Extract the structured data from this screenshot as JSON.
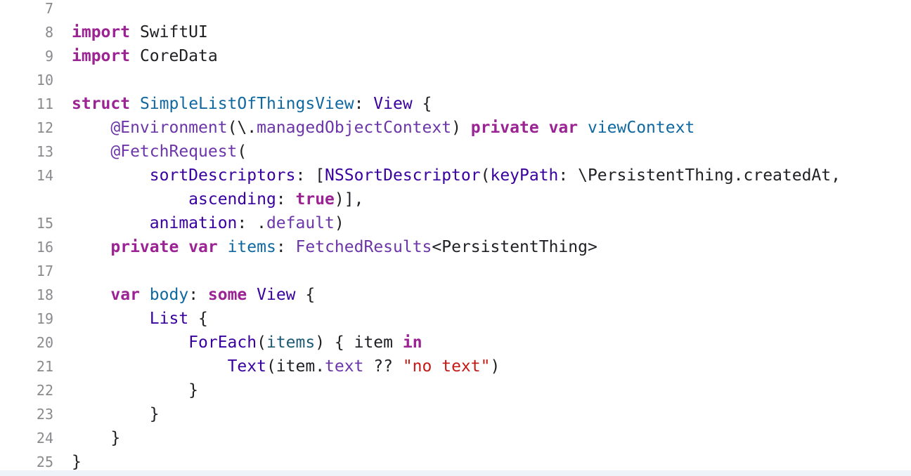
{
  "editor": {
    "lines": [
      {
        "num": "7",
        "tokens": []
      },
      {
        "num": "8",
        "tokens": [
          {
            "t": "import",
            "c": "kw"
          },
          {
            "t": " SwiftUI",
            "c": "plain"
          }
        ]
      },
      {
        "num": "9",
        "tokens": [
          {
            "t": "import",
            "c": "kw"
          },
          {
            "t": " CoreData",
            "c": "plain"
          }
        ]
      },
      {
        "num": "10",
        "tokens": []
      },
      {
        "num": "11",
        "tokens": [
          {
            "t": "struct",
            "c": "kw"
          },
          {
            "t": " ",
            "c": "plain"
          },
          {
            "t": "SimpleListOfThingsView",
            "c": "decl"
          },
          {
            "t": ": ",
            "c": "plain"
          },
          {
            "t": "View",
            "c": "type"
          },
          {
            "t": " {",
            "c": "plain"
          }
        ]
      },
      {
        "num": "12",
        "tokens": [
          {
            "t": "    ",
            "c": "plain"
          },
          {
            "t": "@Environment",
            "c": "prop"
          },
          {
            "t": "(\\.",
            "c": "plain"
          },
          {
            "t": "managedObjectContext",
            "c": "prop"
          },
          {
            "t": ") ",
            "c": "plain"
          },
          {
            "t": "private",
            "c": "kw"
          },
          {
            "t": " ",
            "c": "plain"
          },
          {
            "t": "var",
            "c": "kw"
          },
          {
            "t": " ",
            "c": "plain"
          },
          {
            "t": "viewContext",
            "c": "decl"
          }
        ]
      },
      {
        "num": "13",
        "tokens": [
          {
            "t": "    ",
            "c": "plain"
          },
          {
            "t": "@FetchRequest",
            "c": "prop"
          },
          {
            "t": "(",
            "c": "plain"
          }
        ]
      },
      {
        "num": "14",
        "tokens": [
          {
            "t": "        ",
            "c": "plain"
          },
          {
            "t": "sortDescriptors",
            "c": "type"
          },
          {
            "t": ": [",
            "c": "plain"
          },
          {
            "t": "NSSortDescriptor",
            "c": "type"
          },
          {
            "t": "(",
            "c": "plain"
          },
          {
            "t": "keyPath",
            "c": "type"
          },
          {
            "t": ": \\PersistentThing.createdAt,",
            "c": "plain"
          }
        ]
      },
      {
        "num": "",
        "tokens": [
          {
            "t": "            ",
            "c": "plain"
          },
          {
            "t": "ascending",
            "c": "type"
          },
          {
            "t": ": ",
            "c": "plain"
          },
          {
            "t": "true",
            "c": "kw"
          },
          {
            "t": ")],",
            "c": "plain"
          }
        ]
      },
      {
        "num": "15",
        "tokens": [
          {
            "t": "        ",
            "c": "plain"
          },
          {
            "t": "animation",
            "c": "type"
          },
          {
            "t": ": .",
            "c": "plain"
          },
          {
            "t": "default",
            "c": "prop"
          },
          {
            "t": ")",
            "c": "plain"
          }
        ]
      },
      {
        "num": "16",
        "tokens": [
          {
            "t": "    ",
            "c": "plain"
          },
          {
            "t": "private",
            "c": "kw"
          },
          {
            "t": " ",
            "c": "plain"
          },
          {
            "t": "var",
            "c": "kw"
          },
          {
            "t": " ",
            "c": "plain"
          },
          {
            "t": "items",
            "c": "decl"
          },
          {
            "t": ": ",
            "c": "plain"
          },
          {
            "t": "FetchedResults",
            "c": "prop"
          },
          {
            "t": "<PersistentThing>",
            "c": "plain"
          }
        ]
      },
      {
        "num": "17",
        "tokens": []
      },
      {
        "num": "18",
        "tokens": [
          {
            "t": "    ",
            "c": "plain"
          },
          {
            "t": "var",
            "c": "kw"
          },
          {
            "t": " ",
            "c": "plain"
          },
          {
            "t": "body",
            "c": "decl"
          },
          {
            "t": ": ",
            "c": "plain"
          },
          {
            "t": "some",
            "c": "kw"
          },
          {
            "t": " ",
            "c": "plain"
          },
          {
            "t": "View",
            "c": "type"
          },
          {
            "t": " {",
            "c": "plain"
          }
        ]
      },
      {
        "num": "19",
        "tokens": [
          {
            "t": "        ",
            "c": "plain"
          },
          {
            "t": "List",
            "c": "type"
          },
          {
            "t": " {",
            "c": "plain"
          }
        ]
      },
      {
        "num": "20",
        "tokens": [
          {
            "t": "            ",
            "c": "plain"
          },
          {
            "t": "ForEach",
            "c": "type"
          },
          {
            "t": "(",
            "c": "plain"
          },
          {
            "t": "items",
            "c": "usertype"
          },
          {
            "t": ") { item ",
            "c": "plain"
          },
          {
            "t": "in",
            "c": "kw"
          }
        ]
      },
      {
        "num": "21",
        "tokens": [
          {
            "t": "                ",
            "c": "plain"
          },
          {
            "t": "Text",
            "c": "type"
          },
          {
            "t": "(item.",
            "c": "plain"
          },
          {
            "t": "text",
            "c": "prop"
          },
          {
            "t": " ?? ",
            "c": "plain"
          },
          {
            "t": "\"no text\"",
            "c": "str"
          },
          {
            "t": ")",
            "c": "plain"
          }
        ]
      },
      {
        "num": "22",
        "tokens": [
          {
            "t": "            }",
            "c": "plain"
          }
        ]
      },
      {
        "num": "23",
        "tokens": [
          {
            "t": "        }",
            "c": "plain"
          }
        ]
      },
      {
        "num": "24",
        "tokens": [
          {
            "t": "    }",
            "c": "plain"
          }
        ]
      },
      {
        "num": "25",
        "tokens": [
          {
            "t": "}",
            "c": "plain"
          }
        ]
      }
    ]
  }
}
